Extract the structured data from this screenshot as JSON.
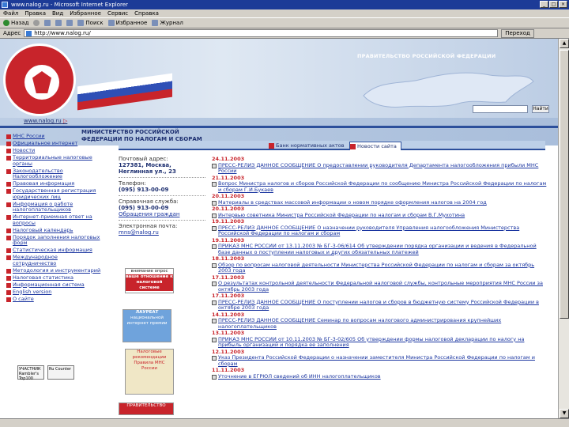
{
  "window": {
    "title": "www.nalog.ru - Microsoft Internet Explorer",
    "buttons": [
      "_",
      "□",
      "×"
    ]
  },
  "menu": [
    "Файл",
    "Правка",
    "Вид",
    "Избранное",
    "Сервис",
    "Справка"
  ],
  "toolbar": {
    "back": "Назад",
    "items": [
      "Поиск",
      "Избранное",
      "Журнал"
    ]
  },
  "address": {
    "label": "Адрес",
    "url": "http://www.nalog.ru/",
    "go": "Переход"
  },
  "header": {
    "ministry": "МИНИСТЕРСТВО РОССИЙСКОЙ ФЕДЕРАЦИИ ПО НАЛОГАМ И СБОРАМ",
    "emblem_ring": "МИНИСТЕРСТВО РОССИЙСКОЙ ФЕДЕРАЦИИ ПО НАЛОГАМ И СБОРАМ",
    "gov_label": "ПРАВИТЕЛЬСТВО РОССИЙСКОЙ ФЕДЕРАЦИИ",
    "search_button": "Найти",
    "site_link": "www.nalog.ru",
    "site_arrow": "▷"
  },
  "sidebar": {
    "items": [
      "МНС России",
      "Официальное интернет",
      "Новости",
      "Территориальные налоговые органы",
      "Законодательство Налогообложение",
      "Правовая информация",
      "Государственная регистрация юридических лиц",
      "Информация о работе налогоплательщиков",
      "Интернет-приемная ответ на вопросы",
      "Налоговый календарь",
      "Порядок заполнения налоговых форм",
      "Статистическая информация",
      "Международное сотрудничество",
      "Методология и инструментарий",
      "Налоговая статистика",
      "Информационная система",
      "English version",
      "О сайте"
    ],
    "badges": [
      "УЧАСТНИК Rambler's Top100",
      "Ru Counter"
    ]
  },
  "tabs": [
    "Банк нормативных актов",
    "Новости сайта"
  ],
  "contact": {
    "address_label": "Почтовый адрес:",
    "address_value": "127381, Москва, Неглинная ул., 23",
    "phone_label": "Телефон:",
    "phone_value": "(095) 913-00-09",
    "help_label": "Справочная служба:",
    "help_value": "(095) 913-00-09",
    "help_link": "Обращения граждан",
    "email_label": "Электронная почта:",
    "email_value": "mns@nalog.ru"
  },
  "banners": {
    "b1_top": "внимание опрос",
    "b1_mid": "ваше отношение к налоговой системе",
    "b2_title": "ЛАУРЕАТ",
    "b2_sub": "национальной интернет премии",
    "b3": "Налоговые рекомендации Правила МНС России",
    "b4": "ПРАВИТЕЛЬСТВО"
  },
  "news": [
    {
      "date": "24.11.2003",
      "text": "ПРЕСС-РЕЛИЗ ДАННОЕ СООБЩЕНИЕ О предоставлении руководителя Департамента налогообложения прибыли МНС России"
    },
    {
      "date": "21.11.2003",
      "text": "Вопрос Министра налогов и сборов Российской Федерации по сообщению Министра Российской Федерации по налогам и сборам Г.И.Букаев"
    },
    {
      "date": "20.11.2003",
      "text": "Материалы в средствах массовой информации о новом порядке оформления налогов на 2004 год"
    },
    {
      "date": "20.11.2003",
      "text": "Интервью советника Министра Российской Федерации по налогам и сборам В.Г.Мухотина"
    },
    {
      "date": "19.11.2003",
      "text": "ПРЕСС-РЕЛИЗ ДАННОЕ СООБЩЕНИЕ О назначении руководителя Управления налогообложения Министерства Российской Федерации по налогам и сборам"
    },
    {
      "date": "19.11.2003",
      "text": "ПРИКАЗ МНС РОССИИ от 13.11.2003 № БГ-3-06/614 Об утверждении порядка организации и ведения в Федеральной базе данных о поступлении налоговых и других обязательных платежей"
    },
    {
      "date": "18.11.2003",
      "text": "Обзор по вопросам налоговой деятельности Министерства Российской Федерации по налогам и сборам за октябрь 2003 года"
    },
    {
      "date": "17.11.2003",
      "text": "О результатах контрольной деятельности Федеральной налоговой службы, контрольные мероприятия МНС России за октябрь 2003 года"
    },
    {
      "date": "17.11.2003",
      "text": "ПРЕСС-РЕЛИЗ ДАННОЕ СООБЩЕНИЕ О поступлении налогов и сборов в бюджетную систему Российской Федерации в октябре 2003 года"
    },
    {
      "date": "14.11.2003",
      "text": "ПРЕСС-РЕЛИЗ ДАННОЕ СООБЩЕНИЕ Семинар по вопросам налогового администрирования крупнейших налогоплательщиков"
    },
    {
      "date": "13.11.2003",
      "text": "ПРИКАЗ МНС РОССИИ от 10.11.2003 № БГ-3-02/605 Об утверждении формы налоговой декларации по налогу на прибыль организаций и порядка ее заполнения"
    },
    {
      "date": "12.11.2003",
      "text": "Указ Президента Российской Федерации о назначении заместителя Министра Российской Федерации по налогам и сборам"
    },
    {
      "date": "11.11.2003",
      "text": "Уточнение в ЕГРЮЛ сведений об ИНН налогоплательщиков"
    }
  ]
}
